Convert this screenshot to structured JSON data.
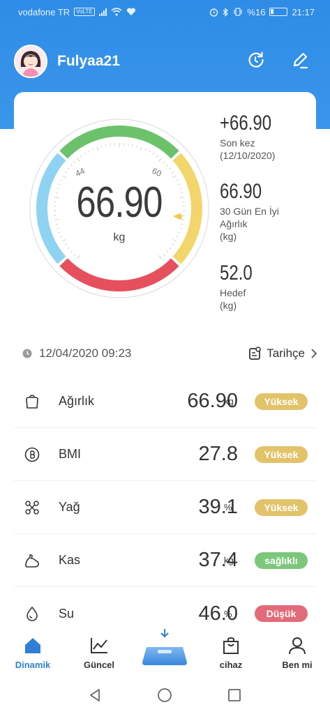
{
  "status_bar": {
    "carrier": "vodafone TR",
    "volte": "VoLTE",
    "battery_percent": "%16",
    "time": "21:17"
  },
  "profile": {
    "username": "Fulyaa21"
  },
  "gauge": {
    "value": "66.90",
    "unit": "kg",
    "tick_left": "44",
    "tick_right": "60"
  },
  "stats": {
    "last_change": {
      "value": "+66.90",
      "label1": "Son kez",
      "label2": "(12/10/2020)"
    },
    "best_30": {
      "value": "66.90",
      "label1": "30 Gün En İyi",
      "label2": "Ağırlık",
      "label3": "(kg)"
    },
    "target": {
      "value": "52.0",
      "label1": "Hedef",
      "label2": "(kg)"
    }
  },
  "measurement": {
    "datetime": "12/04/2020 09:23",
    "history_label": "Tarihçe"
  },
  "metrics": [
    {
      "label": "Ağırlık",
      "value": "66.90",
      "unit": "kg",
      "status": "Yüksek",
      "status_color": "#e2c36a"
    },
    {
      "label": "BMI",
      "value": "27.8",
      "unit": "",
      "status": "Yüksek",
      "status_color": "#e2c36a"
    },
    {
      "label": "Yağ",
      "value": "39.1",
      "unit": "%",
      "status": "Yüksek",
      "status_color": "#e2c36a"
    },
    {
      "label": "Kas",
      "value": "37.4",
      "unit": "kg",
      "status": "sağlıklı",
      "status_color": "#7cc77b"
    },
    {
      "label": "Su",
      "value": "46.0",
      "unit": "%",
      "status": "Düşük",
      "status_color": "#e36a78"
    }
  ],
  "tabs": [
    {
      "label": "Dinamik",
      "icon": "home-icon"
    },
    {
      "label": "Güncel",
      "icon": "chart-icon"
    },
    {
      "label": "",
      "icon": "scale-icon"
    },
    {
      "label": "cihaz",
      "icon": "bag-icon"
    },
    {
      "label": "Ben mi",
      "icon": "person-icon"
    }
  ],
  "colors": {
    "header_blue": "#2f8ce6",
    "gauge_green": "#6cc26b",
    "gauge_yellow": "#f2d66b",
    "gauge_red": "#e6505d",
    "gauge_blue": "#8fd3f2",
    "active_tab": "#2f7fd6"
  }
}
